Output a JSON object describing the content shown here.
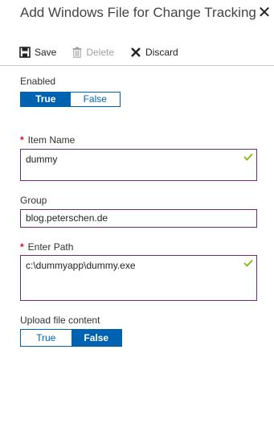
{
  "header": {
    "title": "Add Windows File for Change Tracking",
    "close_icon": "close-icon"
  },
  "toolbar": {
    "save_label": "Save",
    "delete_label": "Delete",
    "discard_label": "Discard"
  },
  "form": {
    "enabled": {
      "label": "Enabled",
      "true_label": "True",
      "false_label": "False",
      "selected": "True"
    },
    "item_name": {
      "label": "Item Name",
      "required": "*",
      "value": "dummy"
    },
    "group": {
      "label": "Group",
      "value": "blog.peterschen.de"
    },
    "enter_path": {
      "label": "Enter Path",
      "required": "*",
      "value": "c:\\dummyapp\\dummy.exe"
    },
    "upload": {
      "label": "Upload file content",
      "true_label": "True",
      "false_label": "False",
      "selected": "False"
    }
  },
  "colors": {
    "accent": "#0063b1",
    "field_border": "#6b2d7e",
    "valid_check": "#7fba00",
    "required": "#e00b1c"
  }
}
